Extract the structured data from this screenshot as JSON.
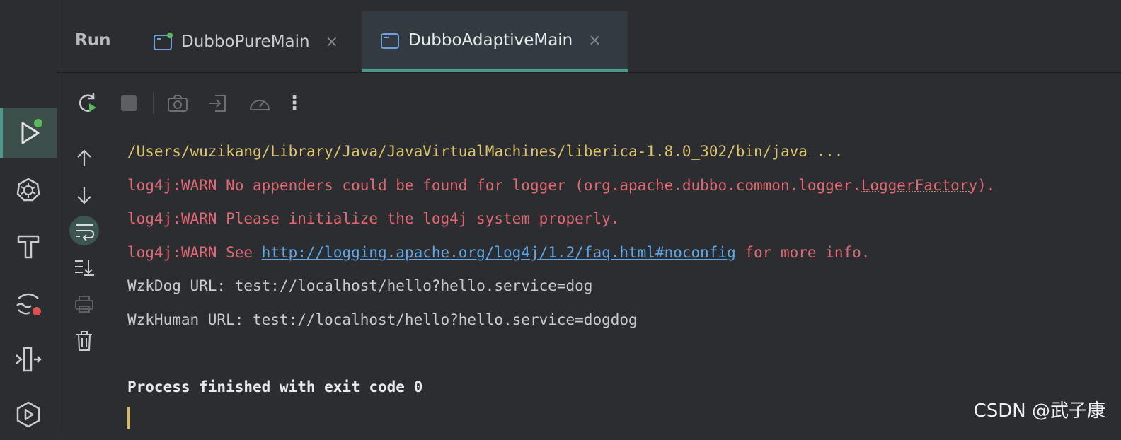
{
  "tool_window": {
    "title": "Run",
    "tabs": [
      {
        "label": "DubboPureMain",
        "status": "running-dot"
      },
      {
        "label": "DubboAdaptiveMain",
        "status": "active"
      }
    ],
    "close_glyph": "×"
  },
  "toolbar": {
    "icons": [
      "rerun-icon",
      "stop-icon",
      "camera-icon",
      "restore-layout-icon",
      "profiler-icon",
      "more-icon"
    ],
    "more_glyph": "⋮"
  },
  "gutter": {
    "icons": [
      "scroll-up-icon",
      "scroll-down-icon",
      "soft-wrap-icon",
      "scroll-to-end-icon",
      "print-icon",
      "clear-icon"
    ]
  },
  "sidebar": {
    "icons": [
      "run-icon",
      "kubernetes-icon",
      "build-icon",
      "problems-icon",
      "structure-icon",
      "services-icon"
    ]
  },
  "console": {
    "lines": [
      {
        "text": "/Users/wuzikang/Library/Java/JavaVirtualMachines/liberica-1.8.0_302/bin/java ..."
      },
      {
        "prefix": "log4j:WARN No appenders could be found for logger (org.apache.dubbo.common.logger.",
        "squiggle": "LoggerFactory",
        "suffix": ")."
      },
      {
        "text": "log4j:WARN Please initialize the log4j system properly."
      },
      {
        "prefix": "log4j:WARN See ",
        "link": "http://logging.apache.org/log4j/1.2/faq.html#noconfig",
        "suffix": " for more info."
      },
      {
        "text": "WzkDog URL: test://localhost/hello?hello.service=dog"
      },
      {
        "text": "WzkHuman URL: test://localhost/hello?hello.service=dogdog"
      },
      {
        "text": ""
      },
      {
        "text": "Process finished with exit code 0"
      }
    ]
  },
  "colors": {
    "path": "#dcc46a",
    "warning": "#e46775",
    "link": "#5fa8e8",
    "accent": "#4d9a8d",
    "running_dot": "#5bb85d",
    "error_dot": "#e05252"
  },
  "watermark": "CSDN @武子康"
}
